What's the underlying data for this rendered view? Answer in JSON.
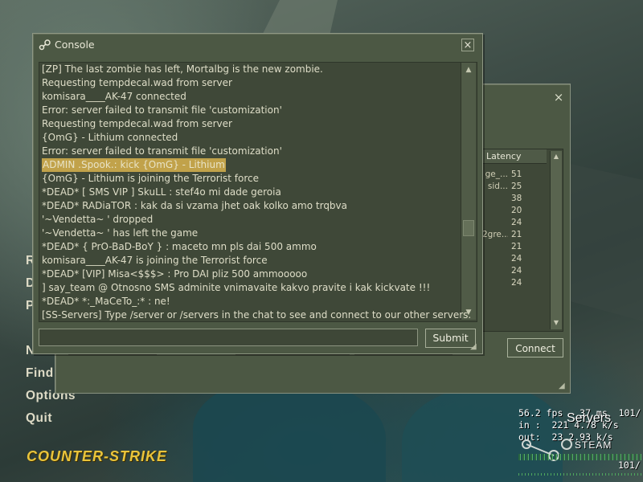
{
  "main_menu": {
    "items": [
      {
        "label": "R"
      },
      {
        "label": "D"
      },
      {
        "label": "P"
      },
      {
        "label": "New"
      },
      {
        "label": "Find"
      },
      {
        "label": "Options"
      },
      {
        "label": "Quit"
      }
    ]
  },
  "logo_text": "COUNTER-STRIKE",
  "netgraph": {
    "fps_line": "56.2 fps   37 ms  101/",
    "in_line": "in :  221 4.78 k/s",
    "out_line": "out:  23 2.93 k/s",
    "right_value": "101/",
    "servers_label": "Servers",
    "steam_label": "STEAM"
  },
  "server_browser": {
    "close_glyph": "×",
    "latency_header": "Latency",
    "rows": [
      {
        "prefix": "ge_...",
        "latency": "51"
      },
      {
        "prefix": "sid...",
        "latency": "25"
      },
      {
        "prefix": "",
        "latency": "38"
      },
      {
        "prefix": "",
        "latency": "20"
      },
      {
        "prefix": "",
        "latency": "24"
      },
      {
        "prefix": "2gre...",
        "latency": "21"
      },
      {
        "prefix": "",
        "latency": "21"
      },
      {
        "prefix": "",
        "latency": "24"
      },
      {
        "prefix": "",
        "latency": "24"
      },
      {
        "prefix": "",
        "latency": "24"
      }
    ],
    "connect_label": "Connect"
  },
  "console": {
    "title": "Console",
    "close_glyph": "×",
    "lines": [
      {
        "text": "[ZP] The last zombie has left, Mortalbg is the new zombie.",
        "highlight": false
      },
      {
        "text": "Requesting tempdecal.wad from server",
        "highlight": false
      },
      {
        "text": "komisara____AK-47 connected",
        "highlight": false
      },
      {
        "text": "Error: server failed to transmit file 'customization'",
        "highlight": false
      },
      {
        "text": "Requesting tempdecal.wad from server",
        "highlight": false
      },
      {
        "text": "{OmG} - Lithium connected",
        "highlight": false
      },
      {
        "text": "Error: server failed to transmit file 'customization'",
        "highlight": false
      },
      {
        "text": "ADMIN .Spook.: kick {OmG} - Lithium",
        "highlight": true
      },
      {
        "text": "{OmG} - Lithium is joining the Terrorist force",
        "highlight": false
      },
      {
        "text": "*DEAD* [ SMS VIP ] SkuLL : stef4o mi dade geroia",
        "highlight": false
      },
      {
        "text": "*DEAD* RADiaTOR : kak da si vzama jhet oak kolko amo trqbva",
        "highlight": false
      },
      {
        "text": "'~Vendetta~     ' dropped",
        "highlight": false
      },
      {
        "text": "'~Vendetta~     ' has left the game",
        "highlight": false
      },
      {
        "text": "*DEAD* { PrO-BaD-BoY } : maceto mn pls dai 500 ammo",
        "highlight": false
      },
      {
        "text": "komisara____AK-47 is joining the Terrorist force",
        "highlight": false
      },
      {
        "text": "*DEAD* [VIP] Misa<$$$> : Pro DAI pliz 500 ammooooo",
        "highlight": false
      },
      {
        "text": "] say_team @ Otnosno SMS adminite vnimavaite kakvo pravite i kak kickvate !!!",
        "highlight": false
      },
      {
        "text": "*DEAD* *:_MaCeTo_:* : ne!",
        "highlight": false
      },
      {
        "text": "[SS-Servers] Type /server or /servers in the chat to see and connect to our other servers.",
        "highlight": false
      }
    ],
    "input_value": "",
    "submit_label": "Submit",
    "scroll_up_icon": "▲",
    "scroll_down_icon": "▼"
  },
  "colors": {
    "panel_bg": "#4c5844",
    "text_inset_bg": "#3f4838",
    "highlight": "#c1a24a",
    "logo_yellow": "#e9c43b"
  }
}
